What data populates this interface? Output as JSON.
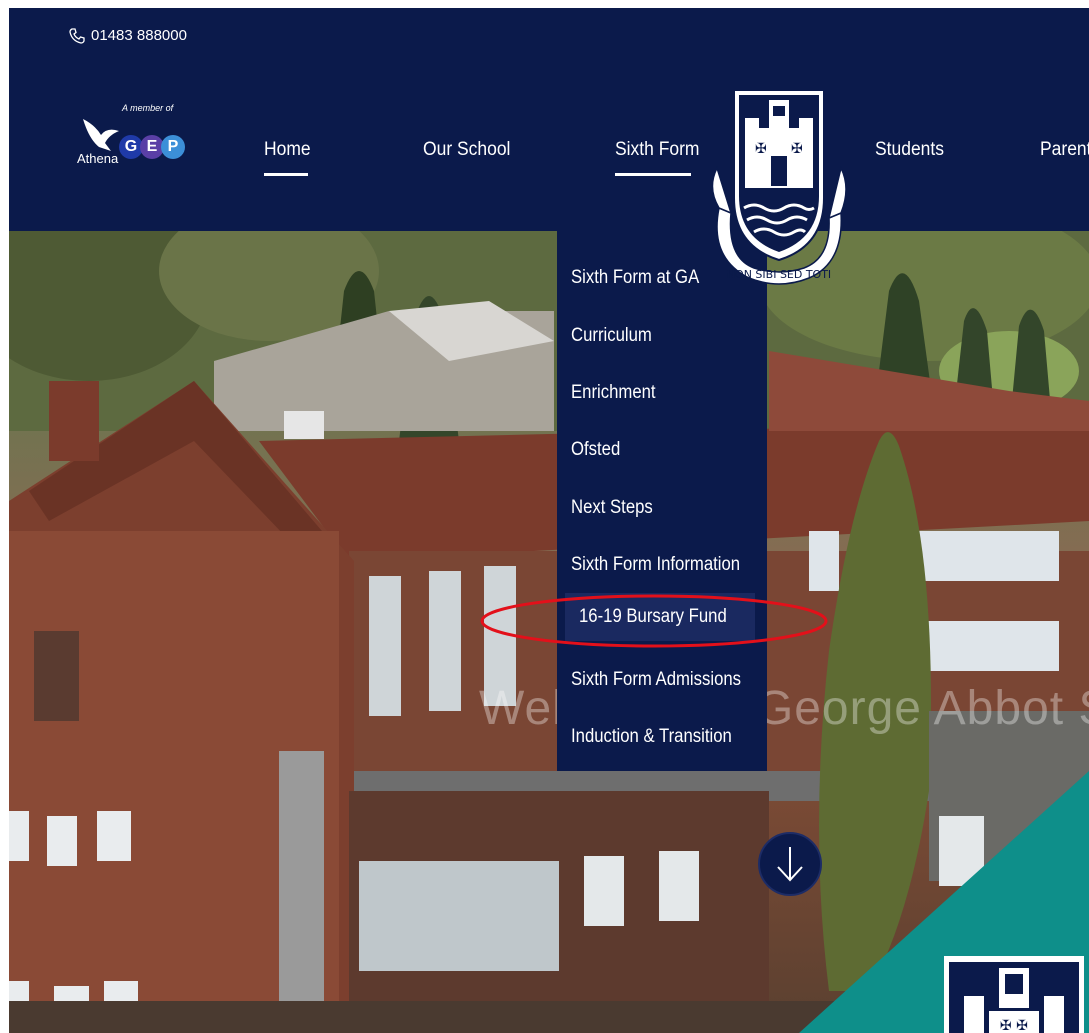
{
  "header": {
    "phone": "01483 888000",
    "logo": {
      "member_text": "A member of",
      "athena_text": "Athena",
      "letters": [
        "G",
        "E",
        "P"
      ]
    }
  },
  "nav": {
    "items": [
      {
        "label": "Home",
        "active": true
      },
      {
        "label": "Our School",
        "active": false
      },
      {
        "label": "Sixth Form",
        "active": true
      },
      {
        "label": "Students",
        "active": false
      },
      {
        "label": "Parents",
        "active": false
      }
    ]
  },
  "crest": {
    "motto": "NON SIBI SED TOTI"
  },
  "dropdown": {
    "items": [
      "Sixth Form at GA",
      "Curriculum",
      "Enrichment",
      "Ofsted",
      "Next Steps",
      "Sixth Form Information",
      "16-19 Bursary Fund",
      "Sixth Form Admissions",
      "Induction & Transition"
    ],
    "highlighted_index": 6
  },
  "hero": {
    "welcome_text": "Welcome to George Abbot School"
  },
  "colors": {
    "navy": "#0b1a4b",
    "teal": "#0e8f8a",
    "highlight_ring": "#e3101a"
  },
  "icons": [
    "phone-icon",
    "arrow-down-icon",
    "eagle-icon",
    "crest-icon"
  ]
}
